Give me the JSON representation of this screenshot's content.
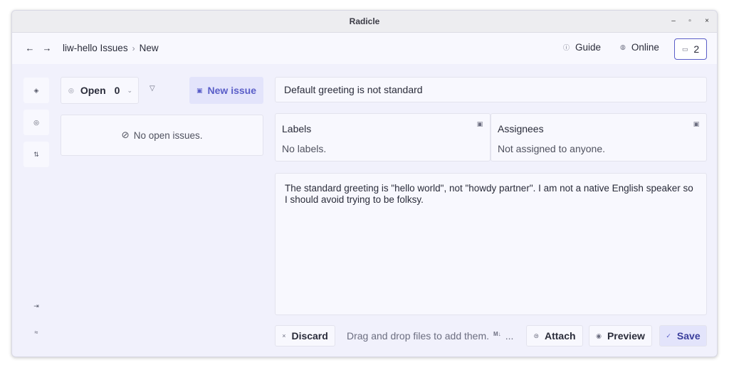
{
  "window": {
    "title": "Radicle",
    "controls": {
      "minimize": "–",
      "maximize": "▫",
      "close": "×"
    }
  },
  "topbar": {
    "back_icon": "←",
    "forward_icon": "→",
    "breadcrumb": {
      "repo": "liw-hello",
      "section": "Issues",
      "separator": "›",
      "current": "New"
    },
    "guide": {
      "icon": "ⓘ",
      "label": "Guide"
    },
    "online": {
      "icon": "◍",
      "label": "Online"
    },
    "inbox": {
      "icon": "▭",
      "count": "2"
    }
  },
  "sidebar": {
    "items": [
      {
        "name": "repo-icon",
        "glyph": "◈"
      },
      {
        "name": "issues-icon",
        "glyph": "◎"
      },
      {
        "name": "patches-icon",
        "glyph": "⇅"
      }
    ],
    "bottom": [
      {
        "name": "logout-icon",
        "glyph": "⇥"
      },
      {
        "name": "settings-icon",
        "glyph": "≈"
      }
    ]
  },
  "issues_list": {
    "filter": {
      "icon": "◎",
      "label": "Open",
      "count": "0",
      "chevron": "⌄"
    },
    "funnel_icon": "▽",
    "new_issue": {
      "icon": "▣",
      "label": "New issue"
    },
    "empty": {
      "icon": "⊘",
      "text": "No open issues."
    }
  },
  "editor": {
    "title_value": "Default greeting is not standard",
    "labels": {
      "header": "Labels",
      "value": "No labels.",
      "edit_icon": "▣"
    },
    "assignees": {
      "header": "Assignees",
      "value": "Not assigned to anyone.",
      "edit_icon": "▣"
    },
    "body_value": "The standard greeting is \"hello world\", not \"howdy partner\". I am not a native English speaker so I should avoid trying to be folksy."
  },
  "actions": {
    "discard": {
      "icon": "×",
      "label": "Discard"
    },
    "drag_text": "Drag and drop files to add them.",
    "markdown_badge": "M↓",
    "ellipsis": "...",
    "attach": {
      "icon": "⊜",
      "label": "Attach"
    },
    "preview": {
      "icon": "◉",
      "label": "Preview"
    },
    "save": {
      "icon": "✓",
      "label": "Save"
    }
  }
}
